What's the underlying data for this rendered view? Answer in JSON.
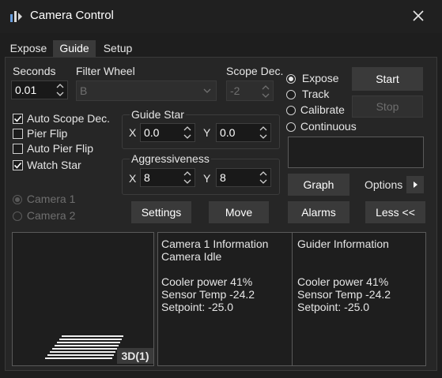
{
  "window": {
    "title": "Camera Control"
  },
  "tabs": [
    "Expose",
    "Guide",
    "Setup"
  ],
  "active_tab": "Guide",
  "seconds": {
    "label": "Seconds",
    "value": "0.01"
  },
  "filter_wheel": {
    "label": "Filter Wheel",
    "value": "B"
  },
  "scope_dec": {
    "label": "Scope Dec.",
    "value": "-2"
  },
  "mode": {
    "options": [
      "Expose",
      "Track",
      "Calibrate",
      "Continuous"
    ],
    "selected": "Expose"
  },
  "buttons": {
    "start": "Start",
    "stop": "Stop",
    "graph": "Graph",
    "options": "Options",
    "settings": "Settings",
    "move": "Move",
    "alarms": "Alarms",
    "less": "Less <<"
  },
  "checkboxes": [
    {
      "label": "Auto Scope Dec.",
      "checked": true
    },
    {
      "label": "Pier Flip",
      "checked": false
    },
    {
      "label": "Auto Pier Flip",
      "checked": false
    },
    {
      "label": "Watch Star",
      "checked": true
    }
  ],
  "guide_star": {
    "label": "Guide Star",
    "x_label": "X",
    "x": "0.0",
    "y_label": "Y",
    "y": "0.0"
  },
  "aggressiveness": {
    "label": "Aggressiveness",
    "x_label": "X",
    "x": "8",
    "y_label": "Y",
    "y": "8"
  },
  "camera_select": {
    "options": [
      "Camera 1",
      "Camera 2"
    ],
    "selected": "Camera 1"
  },
  "preview": {
    "badge": "3D(1)"
  },
  "camera_info": {
    "lines": [
      "Camera 1 Information",
      "Camera Idle",
      "",
      "Cooler power 41%",
      "Sensor Temp -24.2",
      "Setpoint: -25.0"
    ]
  },
  "guider_info": {
    "lines": [
      "Guider Information",
      "",
      "",
      "Cooler power 41%",
      "Sensor Temp -24.2",
      "Setpoint: -25.0"
    ]
  },
  "colors": {
    "background": "#1e1e1e",
    "panel": "#262626",
    "button": "#3a3a3a",
    "text": "#e6e6e6"
  },
  "icons": [
    "app-icon",
    "close-icon",
    "spin-icon",
    "dropdown-arrow-icon",
    "arrow-right-icon"
  ]
}
